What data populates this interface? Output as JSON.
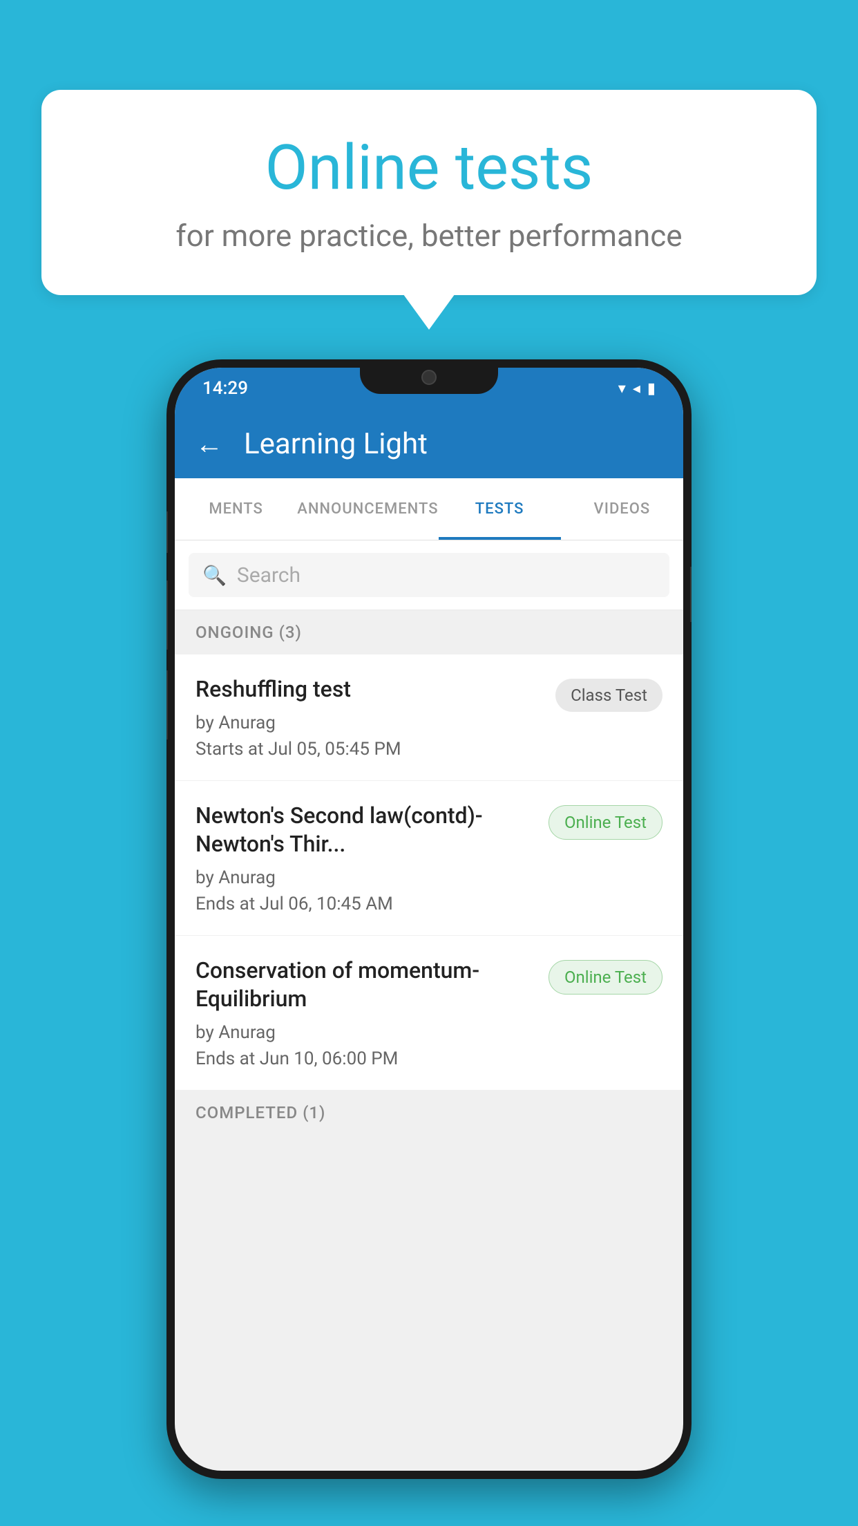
{
  "background_color": "#29b6d8",
  "speech_bubble": {
    "title": "Online tests",
    "subtitle": "for more practice, better performance"
  },
  "phone": {
    "status_bar": {
      "time": "14:29",
      "icons": [
        "wifi",
        "signal",
        "battery"
      ]
    },
    "app_bar": {
      "back_label": "←",
      "title": "Learning Light"
    },
    "tabs": [
      {
        "label": "MENTS",
        "active": false
      },
      {
        "label": "ANNOUNCEMENTS",
        "active": false
      },
      {
        "label": "TESTS",
        "active": true
      },
      {
        "label": "VIDEOS",
        "active": false
      }
    ],
    "search": {
      "placeholder": "Search"
    },
    "sections": [
      {
        "header": "ONGOING (3)",
        "tests": [
          {
            "name": "Reshuffling test",
            "author": "by Anurag",
            "time_label": "Starts at",
            "time": "Jul 05, 05:45 PM",
            "badge": "Class Test",
            "badge_type": "class"
          },
          {
            "name": "Newton's Second law(contd)-Newton's Thir...",
            "author": "by Anurag",
            "time_label": "Ends at",
            "time": "Jul 06, 10:45 AM",
            "badge": "Online Test",
            "badge_type": "online"
          },
          {
            "name": "Conservation of momentum-Equilibrium",
            "author": "by Anurag",
            "time_label": "Ends at",
            "time": "Jun 10, 06:00 PM",
            "badge": "Online Test",
            "badge_type": "online"
          }
        ]
      }
    ],
    "completed_header": "COMPLETED (1)"
  }
}
